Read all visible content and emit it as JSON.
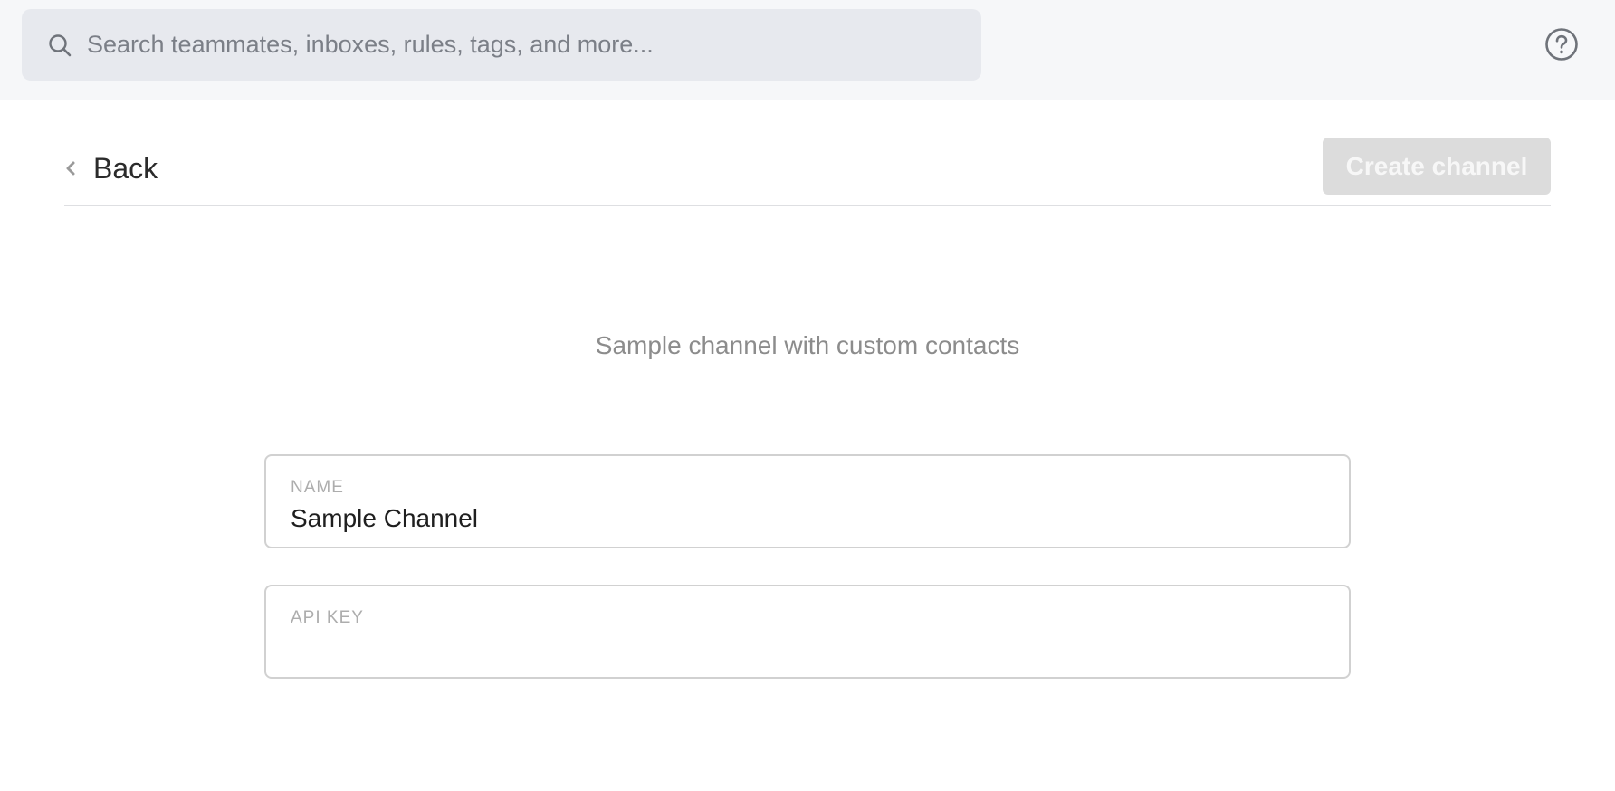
{
  "search": {
    "placeholder": "Search teammates, inboxes, rules, tags, and more...",
    "icon": "search-icon"
  },
  "help": {
    "icon": "question-circle-icon"
  },
  "header": {
    "back_label": "Back",
    "back_icon": "chevron-left-icon",
    "create_label": "Create channel"
  },
  "subtitle": "Sample channel with custom contacts",
  "form": {
    "name": {
      "label": "NAME",
      "value": "Sample Channel"
    },
    "api_key": {
      "label": "API KEY",
      "value": ""
    }
  },
  "colors": {
    "topbar_bg": "#f6f7f9",
    "search_bg": "#e7e9ee",
    "button_disabled_bg": "#dcdcdc"
  }
}
